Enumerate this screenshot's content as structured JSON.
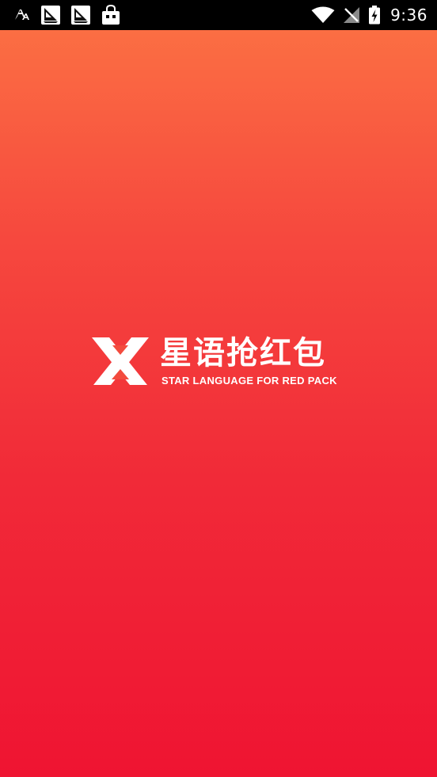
{
  "status_bar": {
    "time": "9:36",
    "left_icons": [
      "font-icon",
      "sailboat-notification-icon",
      "sailboat-notification-icon",
      "shopping-bag-icon"
    ],
    "right_icons": [
      "wifi-icon",
      "no-signal-icon",
      "battery-charging-icon"
    ]
  },
  "splash": {
    "brand_name": "星语抢红包",
    "tagline": "STAR LANGUAGE FOR RED PACK",
    "gradient_colors": [
      "#fb6e43",
      "#f6483e",
      "#f12a38",
      "#ef1432"
    ]
  }
}
